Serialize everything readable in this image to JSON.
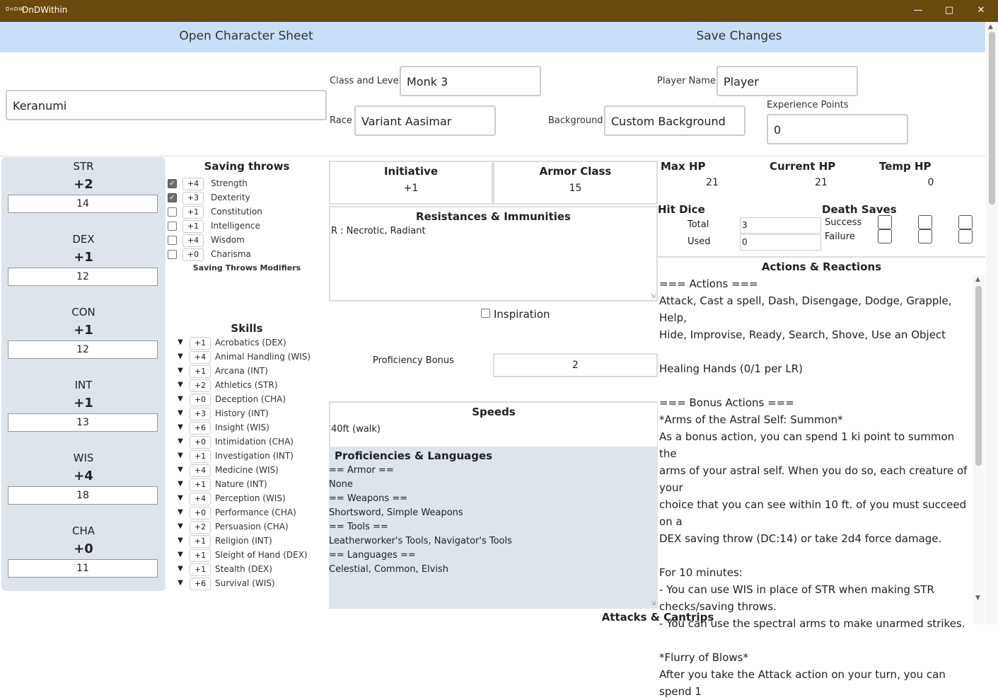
{
  "window": {
    "title": "DnDWithin",
    "logo_text": "DnDW"
  },
  "toolbar": {
    "open_label": "Open Character Sheet",
    "save_label": "Save Changes"
  },
  "character": {
    "name": "Keranumi",
    "class_level_label": "Class and Level",
    "class_level": "Monk 3",
    "race_label": "Race",
    "race": "Variant Aasimar",
    "player_label": "Player Name",
    "player": "Player",
    "background_label": "Background",
    "background": "Custom Background",
    "xp_label": "Experience Points",
    "xp": "0"
  },
  "abilities": [
    {
      "name": "STR",
      "mod": "+2",
      "score": "14"
    },
    {
      "name": "DEX",
      "mod": "+1",
      "score": "12"
    },
    {
      "name": "CON",
      "mod": "+1",
      "score": "12"
    },
    {
      "name": "INT",
      "mod": "+1",
      "score": "13"
    },
    {
      "name": "WIS",
      "mod": "+4",
      "score": "18"
    },
    {
      "name": "CHA",
      "mod": "+0",
      "score": "11"
    }
  ],
  "saving_throws": {
    "title": "Saving throws",
    "modifiers_label": "Saving Throws Modifiers",
    "items": [
      {
        "name": "Strength",
        "mod": "+4",
        "proficient": true
      },
      {
        "name": "Dexterity",
        "mod": "+3",
        "proficient": true
      },
      {
        "name": "Constitution",
        "mod": "+1",
        "proficient": false
      },
      {
        "name": "Intelligence",
        "mod": "+1",
        "proficient": false
      },
      {
        "name": "Wisdom",
        "mod": "+4",
        "proficient": false
      },
      {
        "name": "Charisma",
        "mod": "+0",
        "proficient": false
      }
    ]
  },
  "skills": {
    "title": "Skills",
    "items": [
      {
        "name": "Acrobatics (DEX)",
        "mod": "+1"
      },
      {
        "name": "Animal Handling (WIS)",
        "mod": "+4"
      },
      {
        "name": "Arcana (INT)",
        "mod": "+1"
      },
      {
        "name": "Athletics (STR)",
        "mod": "+2"
      },
      {
        "name": "Deception (CHA)",
        "mod": "+0"
      },
      {
        "name": "History (INT)",
        "mod": "+3"
      },
      {
        "name": "Insight (WIS)",
        "mod": "+6"
      },
      {
        "name": "Intimidation (CHA)",
        "mod": "+0"
      },
      {
        "name": "Investigation (INT)",
        "mod": "+1"
      },
      {
        "name": "Medicine (WIS)",
        "mod": "+4"
      },
      {
        "name": "Nature (INT)",
        "mod": "+1"
      },
      {
        "name": "Perception (WIS)",
        "mod": "+4"
      },
      {
        "name": "Performance (CHA)",
        "mod": "+0"
      },
      {
        "name": "Persuasion (CHA)",
        "mod": "+2"
      },
      {
        "name": "Religion (INT)",
        "mod": "+1"
      },
      {
        "name": "Sleight of Hand (DEX)",
        "mod": "+1"
      },
      {
        "name": "Stealth (DEX)",
        "mod": "+1"
      },
      {
        "name": "Survival (WIS)",
        "mod": "+6"
      }
    ]
  },
  "combat": {
    "initiative_label": "Initiative",
    "initiative": "+1",
    "ac_label": "Armor Class",
    "ac": "15",
    "resist_label": "Resistances & Immunities",
    "resist": "R : Necrotic, Radiant",
    "inspiration_label": "Inspiration",
    "prof_bonus_label": "Proficiency Bonus",
    "prof_bonus": "2",
    "speeds_label": "Speeds",
    "speeds": "40ft (walk)"
  },
  "proficiencies": {
    "title": "Proficiencies & Languages",
    "lines": [
      "== Armor ==",
      "None",
      "== Weapons ==",
      "Shortsword, Simple Weapons",
      "== Tools ==",
      "Leatherworker's Tools, Navigator's Tools",
      "== Languages ==",
      "Celestial, Common, Elvish"
    ]
  },
  "hp": {
    "max_label": "Max HP",
    "max": "21",
    "current_label": "Current HP",
    "current": "21",
    "temp_label": "Temp HP",
    "temp": "0"
  },
  "hit_dice": {
    "title": "Hit Dice",
    "total_label": "Total",
    "total": "3",
    "used_label": "Used",
    "used": "0"
  },
  "death_saves": {
    "title": "Death Saves",
    "success_label": "Success",
    "failure_label": "Failure"
  },
  "actions": {
    "title": "Actions & Reactions",
    "lines": [
      "=== Actions ===",
      "Attack, Cast a spell, Dash, Disengage, Dodge, Grapple, Help,",
      "Hide, Improvise, Ready, Search, Shove, Use an Object",
      "",
      "Healing Hands (0/1 per LR)",
      "",
      "=== Bonus Actions ===",
      "*Arms of the Astral Self: Summon*",
      "As a bonus action, you can spend 1 ki point to summon the",
      "arms of your astral self. When you do so, each creature of your",
      "choice that you can see within 10 ft. of you must succeed on a",
      "DEX saving throw (DC:14) or take 2d4 force damage.",
      "",
      "For 10 minutes:",
      "- You can use WIS in place of STR when making STR",
      "checks/saving throws.",
      "- You can use the spectral arms to make unarmed strikes.",
      "",
      "*Flurry of Blows*",
      "After you take the Attack action on your turn, you can spend 1"
    ]
  },
  "attacks": {
    "title": "Attacks & Cantrips"
  }
}
